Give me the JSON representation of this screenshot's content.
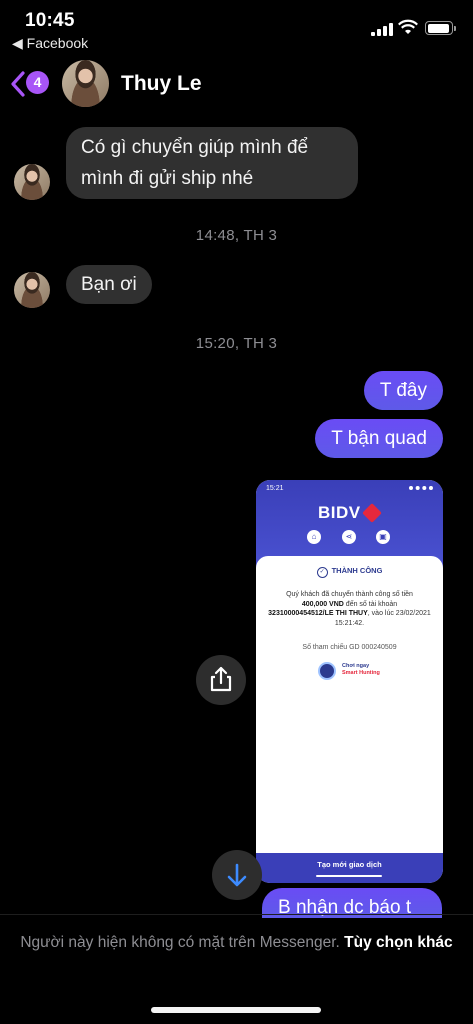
{
  "status_bar": {
    "time": "10:45",
    "back_app": "◀ Facebook"
  },
  "header": {
    "unread_count": "4",
    "contact_name": "Thuy Le"
  },
  "messages": [
    {
      "side": "in",
      "lines": [
        "Có gì chuyển giúp mình để",
        "mình đi gửi ship nhé"
      ]
    },
    {
      "timestamp": "14:48, TH 3"
    },
    {
      "side": "in",
      "text": "Bạn ơi"
    },
    {
      "timestamp": "15:20, TH 3"
    },
    {
      "side": "out",
      "text": "T đây"
    },
    {
      "side": "out",
      "text": "T bận quad"
    },
    {
      "side": "out",
      "text": "B nhận dc báo t"
    }
  ],
  "attachment": {
    "time": "15:21",
    "bank_logo": "BIDV",
    "status": "THÀNH CÔNG",
    "line_prefix": "Quý khách đã chuyển thành công số tiền",
    "amount": "400,000 VND",
    "line_mid": "đến số tài khoản",
    "account": "32310000454512/LE THI THUY",
    "line_time": ", vào lúc 23/02/2021 15:21:42.",
    "reference": "Số tham chiếu GD 000240509",
    "promo_line1": "Chơi ngay",
    "promo_line2": "Smart Hunting",
    "footer_button": "Tạo mới giao dịch"
  },
  "footer": {
    "notice": "Người này hiện không có mặt trên Messenger.",
    "more_options": "Tùy chọn khác"
  },
  "colors": {
    "outgoing_bubble": "#6a4cf5",
    "incoming_bubble": "#303030",
    "badge": "#a855f7",
    "timestamp": "#8e8e93",
    "bidv_blue": "#3a3fb8",
    "bidv_red": "#e5283d"
  }
}
